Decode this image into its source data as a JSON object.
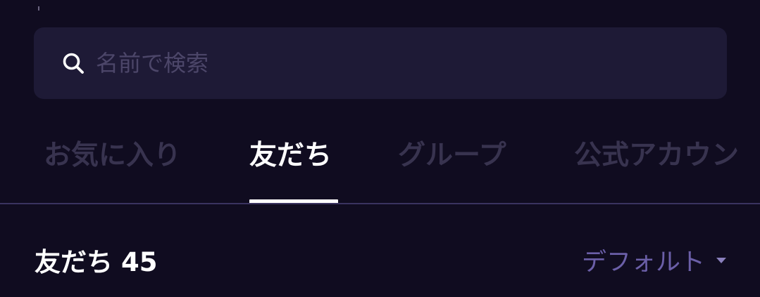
{
  "search": {
    "placeholder": "名前で検索",
    "icon": "search-icon"
  },
  "tabs": [
    {
      "label": "お気に入り",
      "active": false
    },
    {
      "label": "友だち",
      "active": true
    },
    {
      "label": "グループ",
      "active": false
    },
    {
      "label": "公式アカウン",
      "active": false
    }
  ],
  "list": {
    "title": "友だち",
    "count": "45",
    "sort_label": "デフォルト"
  },
  "colors": {
    "background": "#100c20",
    "search_bg": "#1e1a36",
    "accent": "#6b5fa8",
    "tab_inactive": "#38334f",
    "divider": "#3a3360"
  }
}
